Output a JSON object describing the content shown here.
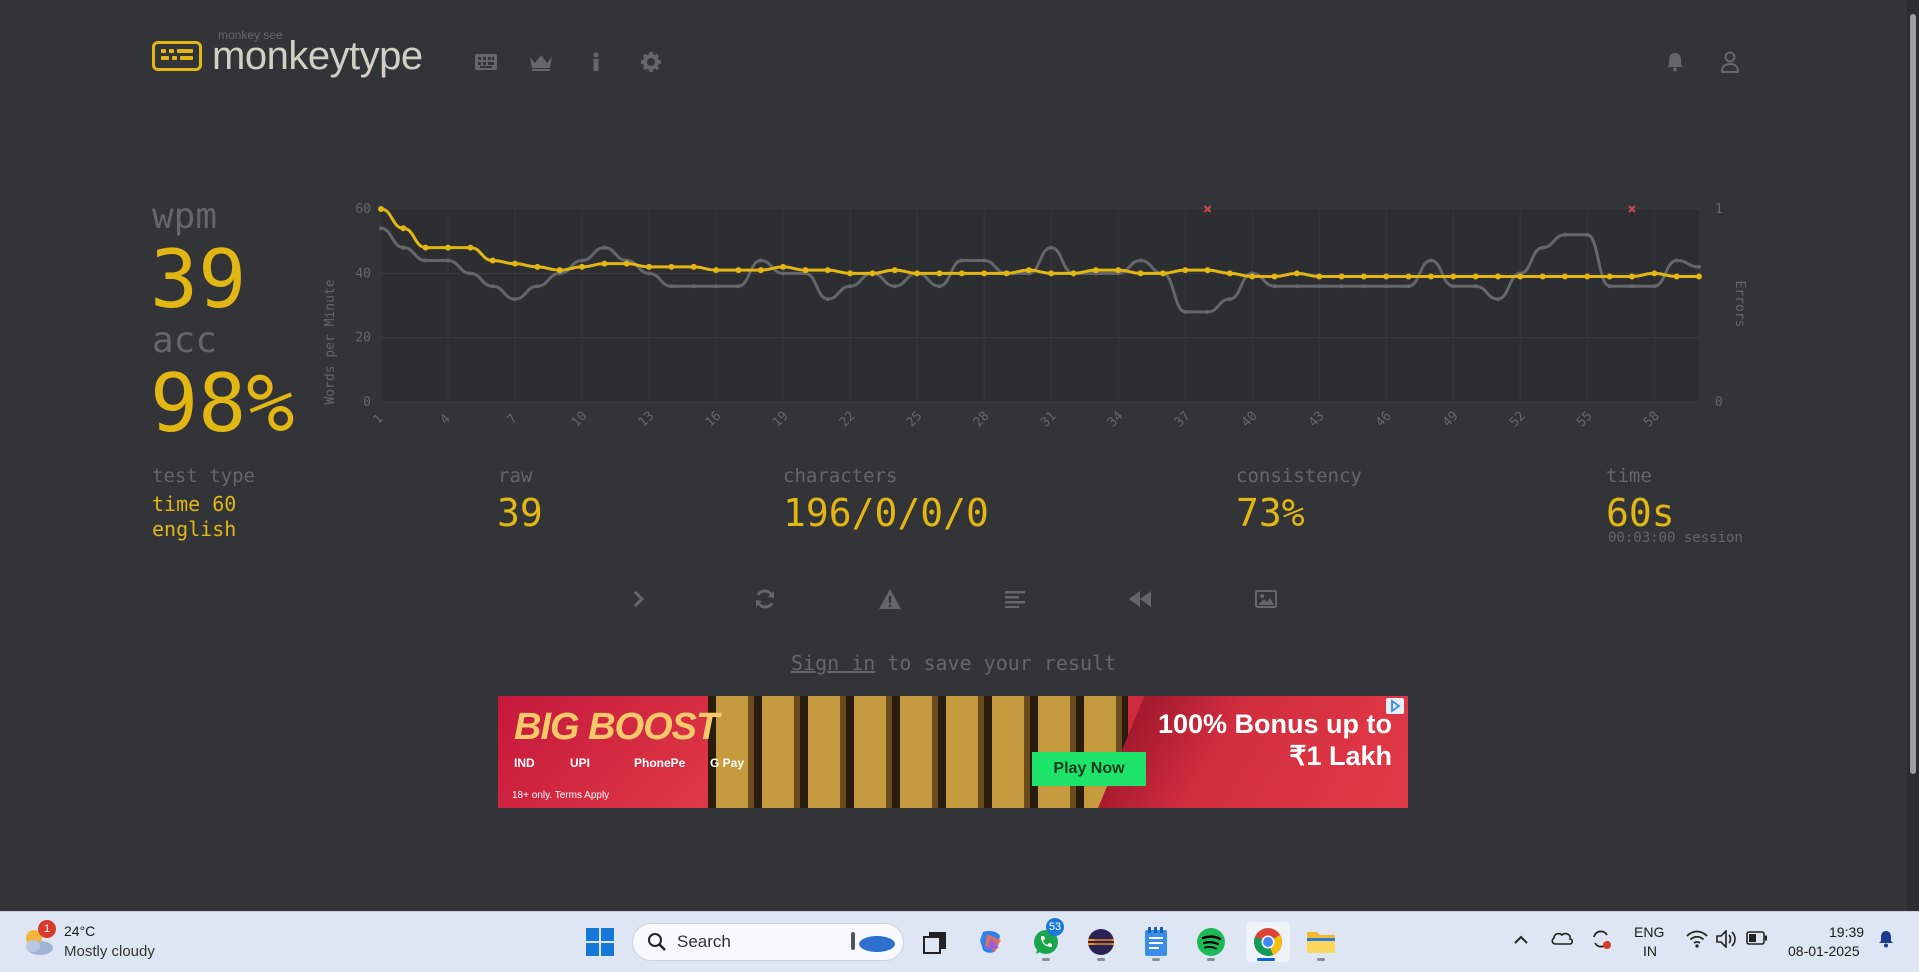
{
  "app": {
    "logo_sub": "monkey see",
    "logo_title": "monkeytype"
  },
  "result": {
    "wpm_label": "wpm",
    "wpm_value": "39",
    "acc_label": "acc",
    "acc_value": "98%",
    "test_type_label": "test type",
    "test_type_line1": "time 60",
    "test_type_line2": "english",
    "raw_label": "raw",
    "raw_value": "39",
    "characters_label": "characters",
    "characters_value": "196/0/0/0",
    "consistency_label": "consistency",
    "consistency_value": "73%",
    "time_label": "time",
    "time_value": "60s",
    "session_text": "00:03:00 session"
  },
  "signin": {
    "link": "Sign in",
    "rest": " to save your result"
  },
  "ad": {
    "big_text": "BIG BOOST",
    "pay1": "IND",
    "pay2": "UPI",
    "pay3": "PhonePe",
    "pay4": "G Pay",
    "terms": "18+ only. Terms Apply",
    "headline1": "100% Bonus up to",
    "headline2": "₹1 Lakh",
    "button": "Play Now"
  },
  "taskbar": {
    "weather_temp": "24°C",
    "weather_desc": "Mostly cloudy",
    "weather_badge": "1",
    "search_placeholder": "Search",
    "whatsapp_badge": "53",
    "lang1": "ENG",
    "lang2": "IN",
    "time": "19:39",
    "date": "08-01-2025"
  },
  "chart_data": {
    "type": "line",
    "ylabel": "Words per Minute",
    "y2label": "Errors",
    "ylim": [
      0,
      60
    ],
    "y2lim": [
      0,
      1
    ],
    "yticks": [
      "0",
      "20",
      "40",
      "60"
    ],
    "y2ticks": [
      "0",
      "1"
    ],
    "x": [
      1,
      2,
      3,
      4,
      5,
      6,
      7,
      8,
      9,
      10,
      11,
      12,
      13,
      14,
      15,
      16,
      17,
      18,
      19,
      20,
      21,
      22,
      23,
      24,
      25,
      26,
      27,
      28,
      29,
      30,
      31,
      32,
      33,
      34,
      35,
      36,
      37,
      38,
      39,
      40,
      41,
      42,
      43,
      44,
      45,
      46,
      47,
      48,
      49,
      50,
      51,
      52,
      53,
      54,
      55,
      56,
      57,
      58,
      59,
      60
    ],
    "xticks": [
      "1",
      "4",
      "7",
      "10",
      "13",
      "16",
      "19",
      "22",
      "25",
      "28",
      "31",
      "34",
      "37",
      "40",
      "43",
      "46",
      "49",
      "52",
      "55",
      "58"
    ],
    "series": [
      {
        "color": "#e2b714",
        "values": [
          60,
          54,
          48,
          48,
          48,
          44,
          43,
          42,
          41,
          42,
          43,
          43,
          42,
          42,
          42,
          41,
          41,
          41,
          42,
          41,
          41,
          40,
          40,
          41,
          40,
          40,
          40,
          40,
          40,
          41,
          40,
          40,
          41,
          41,
          40,
          40,
          41,
          41,
          40,
          39,
          39,
          40,
          39,
          39,
          39,
          39,
          39,
          39,
          39,
          39,
          39,
          39,
          39,
          39,
          39,
          39,
          39,
          40,
          39,
          39
        ]
      },
      {
        "color": "#646669",
        "values": [
          54,
          48,
          44,
          44,
          40,
          36,
          32,
          36,
          40,
          44,
          48,
          44,
          40,
          36,
          36,
          36,
          36,
          44,
          40,
          40,
          32,
          36,
          40,
          36,
          40,
          36,
          44,
          44,
          40,
          40,
          48,
          40,
          40,
          40,
          44,
          40,
          28,
          28,
          32,
          40,
          36,
          36,
          36,
          36,
          36,
          36,
          36,
          44,
          36,
          36,
          32,
          40,
          48,
          52,
          52,
          36,
          36,
          36,
          44,
          42
        ]
      }
    ],
    "errors": [
      {
        "x": 38,
        "count": 1
      },
      {
        "x": 57,
        "count": 1
      }
    ],
    "legend": "none",
    "grid": true
  }
}
